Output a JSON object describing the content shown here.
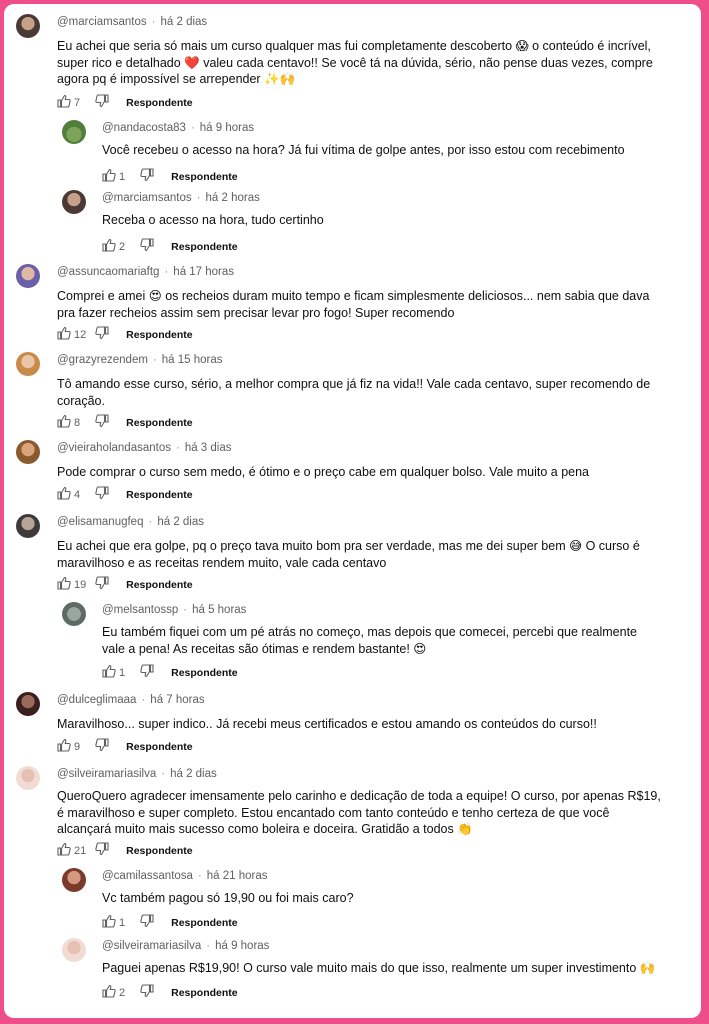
{
  "reply_label": "Respondente",
  "comments": [
    {
      "handle": "@marciamsantos",
      "time": "há 2 dias",
      "likes": "7",
      "lines": [
        "Eu achei que seria só mais um curso qualquer mas fui completamente descoberto 😱 o conteúdo é incrível,",
        "super rico e detalhado ❤️ valeu cada centavo!! Se você tá na dúvida, sério, não pense duas vezes, compre",
        "agora pq é impossível se arrepender ✨🙌"
      ]
    },
    {
      "handle": "@nandacosta83",
      "time": "há 9 horas",
      "likes": "1",
      "lines": [
        "Você recebeu o acesso na hora? Já fui vítima de golpe antes, por isso estou com recebimento"
      ]
    },
    {
      "handle": "@marciamsantos",
      "time": "há 2 horas",
      "likes": "2",
      "lines": [
        "Receba o acesso na hora, tudo certinho"
      ]
    },
    {
      "handle": "@assuncaomariaftg",
      "time": "há 17 horas",
      "likes": "12",
      "lines": [
        "Comprei e amei 😍 os recheios duram muito tempo e ficam simplesmente deliciosos... nem sabia que dava",
        "pra fazer recheios assim sem precisar levar pro fogo! Super recomendo"
      ]
    },
    {
      "handle": "@grazyrezendem",
      "time": "há 15 horas",
      "likes": "8",
      "lines": [
        "Tô amando esse curso, sério, a melhor compra que já fiz na vida!! Vale cada centavo, super recomendo de",
        "coração."
      ]
    },
    {
      "handle": "@vieiraholandasantos",
      "time": "há 3 dias",
      "likes": "4",
      "lines": [
        "Pode comprar o curso sem medo, é ótimo e o preço cabe em qualquer bolso. Vale muito a pena"
      ]
    },
    {
      "handle": "@elisamanugfeq",
      "time": "há 2 dias",
      "likes": "19",
      "lines": [
        "Eu achei que era golpe, pq o preço tava muito bom pra ser verdade, mas me dei super bem 😅 O curso é",
        "maravilhoso e as receitas rendem muito, vale cada centavo"
      ]
    },
    {
      "handle": "@melsantossp",
      "time": "há 5 horas",
      "likes": "1",
      "lines": [
        "Eu também fiquei com um pé atrás no começo, mas depois que comecei, percebi que realmente",
        "vale a pena! As receitas são ótimas e rendem bastante! 😍"
      ]
    },
    {
      "handle": "@dulceglimaaa",
      "time": "há 7 horas",
      "likes": "9",
      "lines": [
        "Maravilhoso... super indico.. Já recebi meus certificados e estou amando os conteúdos do curso!!"
      ]
    },
    {
      "handle": "@silveiramariasilva",
      "time": "há 2 dias",
      "likes": "21",
      "lines": [
        "QueroQuero agradecer imensamente pelo carinho e dedicação de toda a equipe! O curso, por apenas R$19,",
        "é maravilhoso e super completo. Estou encantado com tanto conteúdo e tenho certeza de que você",
        "alcançará muito mais sucesso como boleira e doceira. Gratidão a todos 👏"
      ]
    },
    {
      "handle": "@camilassantosa",
      "time": "há 21 horas",
      "likes": "1",
      "lines": [
        "Vc também pagou só 19,90 ou foi mais caro?"
      ]
    },
    {
      "handle": "@silveiramariasilva",
      "time": "há 9 horas",
      "likes": "2",
      "lines": [
        "Paguei apenas R$19,90! O curso vale muito mais do que isso, realmente um super investimento 🙌"
      ]
    }
  ],
  "colors": {
    "frame": "#ee4e8a",
    "text": "#0f0f0f",
    "muted": "#606060"
  }
}
